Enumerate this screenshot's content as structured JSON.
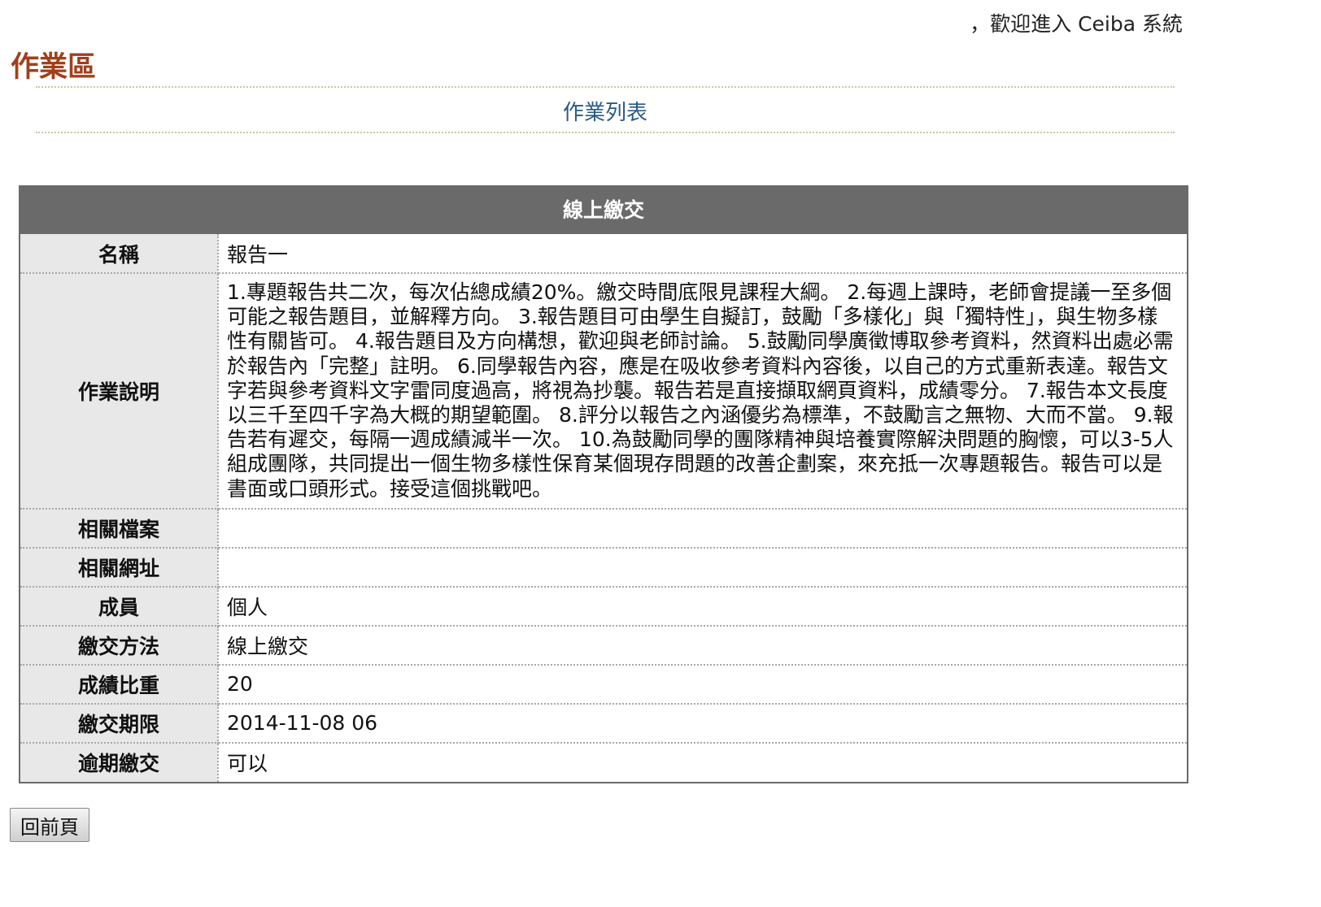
{
  "header": {
    "welcome": "，歡迎進入 Ceiba 系統",
    "area_title": "作業區",
    "list_link": "作業列表"
  },
  "panel": {
    "title": "線上繳交",
    "rows": [
      {
        "label": "名稱",
        "value": "報告一"
      },
      {
        "label": "作業說明",
        "value": "1.專題報告共二次，每次佔總成績20%。繳交時間底限見課程大綱。 2.每週上課時，老師會提議一至多個可能之報告題目，並解釋方向。 3.報告題目可由學生自擬訂，鼓勵「多樣化」與「獨特性」，與生物多樣性有關皆可。 4.報告題目及方向構想，歡迎與老師討論。 5.鼓勵同學廣徵博取參考資料，然資料出處必需於報告內「完整」註明。 6.同學報告內容，應是在吸收參考資料內容後，以自己的方式重新表達。報告文字若與參考資料文字雷同度過高，將視為抄襲。報告若是直接擷取網頁資料，成績零分。 7.報告本文長度以三千至四千字為大概的期望範圍。 8.評分以報告之內涵優劣為標準，不鼓勵言之無物、大而不當。 9.報告若有遲交，每隔一週成績減半一次。 10.為鼓勵同學的團隊精神與培養實際解決問題的胸懷，可以3-5人組成團隊，共同提出一個生物多樣性保育某個現存問題的改善企劃案，來充抵一次專題報告。報告可以是書面或口頭形式。接受這個挑戰吧。"
      },
      {
        "label": "相關檔案",
        "value": ""
      },
      {
        "label": "相關網址",
        "value": ""
      },
      {
        "label": "成員",
        "value": "個人"
      },
      {
        "label": "繳交方法",
        "value": "線上繳交"
      },
      {
        "label": "成績比重",
        "value": "20"
      },
      {
        "label": "繳交期限",
        "value": "2014-11-08 06"
      },
      {
        "label": "逾期繳交",
        "value": "可以"
      }
    ]
  },
  "footer": {
    "back_button": "回前頁"
  },
  "colors": {
    "area_title": "#a0401a",
    "link": "#2a5a86",
    "panel_header": "#6a6a6a",
    "label_bg": "#e8e8e8"
  }
}
